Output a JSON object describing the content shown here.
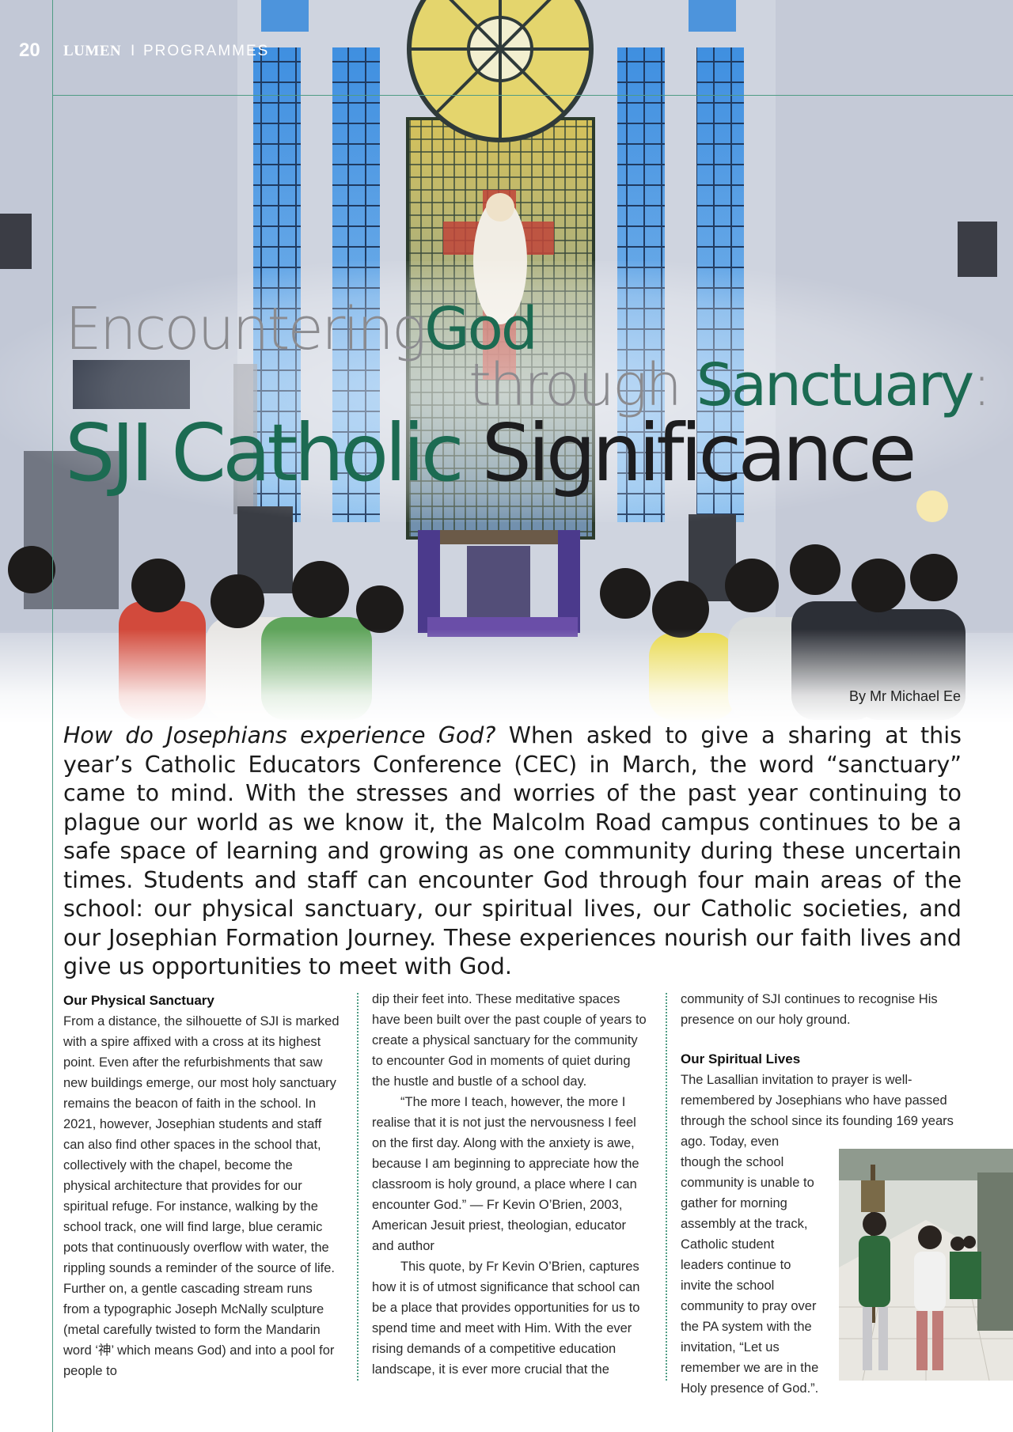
{
  "header": {
    "page_number": "20",
    "magazine": "LUMEN",
    "separator": "I",
    "section": "PROGRAMMES"
  },
  "headline": {
    "part1": "Encountering",
    "part2": "God",
    "part3": "through",
    "part4": "Sanctuary",
    "part5": ":",
    "part6": "SJI Catholic",
    "part7": "Significance"
  },
  "byline": "By Mr Michael Ee",
  "lead": {
    "question": "How do Josephians experience God?",
    "text": " When asked to give a sharing at this year’s Catholic Educators Conference (CEC) in March, the word “sanctuary” came to mind. With the stresses and worries of the past year continuing to plague our world as we know it, the Malcolm Road campus continues to be a safe space of learning and growing as one community during these uncertain times. Students and staff can encounter God through four main areas of the school: our physical sanctuary, our spiritual lives, our Catholic societies, and our Josephian Formation Journey. These experiences nourish our faith lives and give us opportunities to meet with God."
  },
  "columns": {
    "col1_heading": "Our Physical Sanctuary",
    "col1_p1": "From a distance, the silhouette of SJI is marked with a spire affixed with a cross at its highest point. Even after the refurbishments that saw new buildings emerge, our most holy sanctuary remains the beacon of faith in the school. In 2021, however, Josephian students and staff can also find other spaces in the school that, collectively with the chapel, become the physical architecture that provides for our spiritual refuge. For instance, walking by the school track, one will find large, blue ceramic pots that continuously overflow with water, the rippling sounds a reminder of the source of life. Further on, a gentle cascading stream runs from a typographic Joseph McNally sculpture (metal carefully twisted to form the Mandarin word ‘神’ which means God) and into a pool for people to",
    "col2_p1": "dip their feet into. These meditative spaces have been built over the past couple of years to create a physical sanctuary for the community to encounter God in moments of quiet during the hustle and bustle of a school day.",
    "col2_p2": "“The more I teach, however, the more I realise that it is not just the nervousness I feel on the first day. Along with the anxiety is awe, because I am beginning to appreciate how the classroom is holy ground, a place where I can encounter God.” — Fr Kevin O’Brien, 2003, American Jesuit priest, theologian, educator and author",
    "col2_p3": "This quote, by Fr Kevin O’Brien, captures how it is of utmost significance that school can be a place that provides opportunities for us to spend time and meet with Him. With the ever rising demands of a competitive education landscape, it is ever more crucial that the",
    "col3_p1": "community of SJI continues to recognise His presence on our holy ground.",
    "col3_heading": "Our Spiritual Lives",
    "col3_p2a": "The Lasallian invitation to prayer is well-remembered by Josephians who have passed through the school since its founding 169 years",
    "col3_p2b": "ago. Today, even though the school community is unable to gather for morning assembly at the track, Catholic student leaders continue to invite the school community to pray over the PA system with the invitation, “Let us remember we are in the Holy presence of God.”."
  },
  "colors": {
    "accent_green": "#1c6b52",
    "rule_green": "#4f9c84",
    "headline_gray": "#8b8b8f"
  }
}
